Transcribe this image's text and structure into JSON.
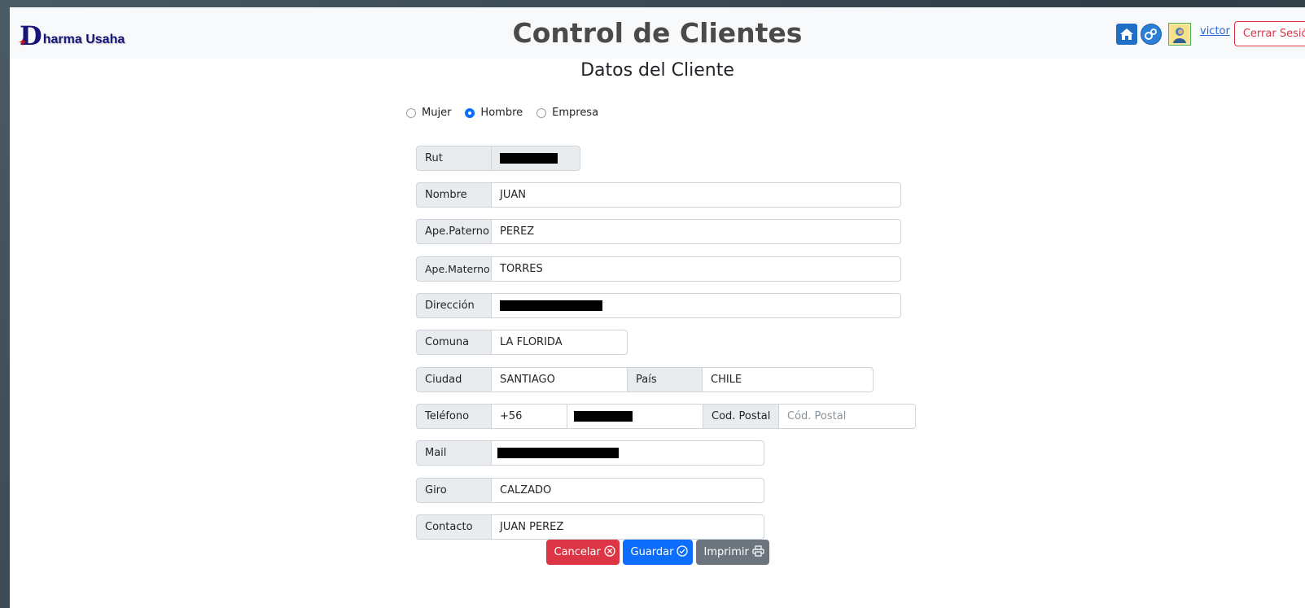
{
  "header": {
    "logo_text": "harma Usaha",
    "logo_initial": "D",
    "title": "Control de Clientes",
    "user_name": "victor",
    "logout_label": "Cerrar Sesión"
  },
  "section_title": "Datos del Cliente",
  "client_type": {
    "options": [
      "Mujer",
      "Hombre",
      "Empresa"
    ],
    "selected": "Hombre"
  },
  "form": {
    "rut": {
      "label": "Rut",
      "value": ""
    },
    "nombre": {
      "label": "Nombre",
      "value": "JUAN"
    },
    "ape_paterno": {
      "label": "Ape.Paterno",
      "value": "PEREZ"
    },
    "ape_materno": {
      "label": "Ape.Materno",
      "value": "TORRES"
    },
    "direccion": {
      "label": "Dirección",
      "value": ""
    },
    "comuna": {
      "label": "Comuna",
      "value": "LA FLORIDA"
    },
    "ciudad": {
      "label": "Ciudad",
      "value": "SANTIAGO"
    },
    "pais": {
      "label": "País",
      "value": "CHILE"
    },
    "telefono": {
      "label": "Teléfono",
      "prefix": "+56",
      "value": ""
    },
    "cod_postal": {
      "label": "Cod. Postal",
      "value": "",
      "placeholder": "Cód. Postal"
    },
    "mail": {
      "label": "Mail",
      "value": ""
    },
    "giro": {
      "label": "Giro",
      "value": "CALZADO"
    },
    "contacto": {
      "label": "Contacto",
      "value": "JUAN PEREZ"
    }
  },
  "actions": {
    "cancel_label": "Cancelar",
    "save_label": "Guardar",
    "print_label": "Imprimir"
  },
  "colors": {
    "primary": "#0d6efd",
    "danger": "#dc3545",
    "secondary": "#6c757d",
    "logo": "#15157a"
  },
  "icons": [
    "home-icon",
    "gears-icon",
    "user-avatar-icon",
    "x-circle-icon",
    "check-circle-icon",
    "printer-icon"
  ]
}
